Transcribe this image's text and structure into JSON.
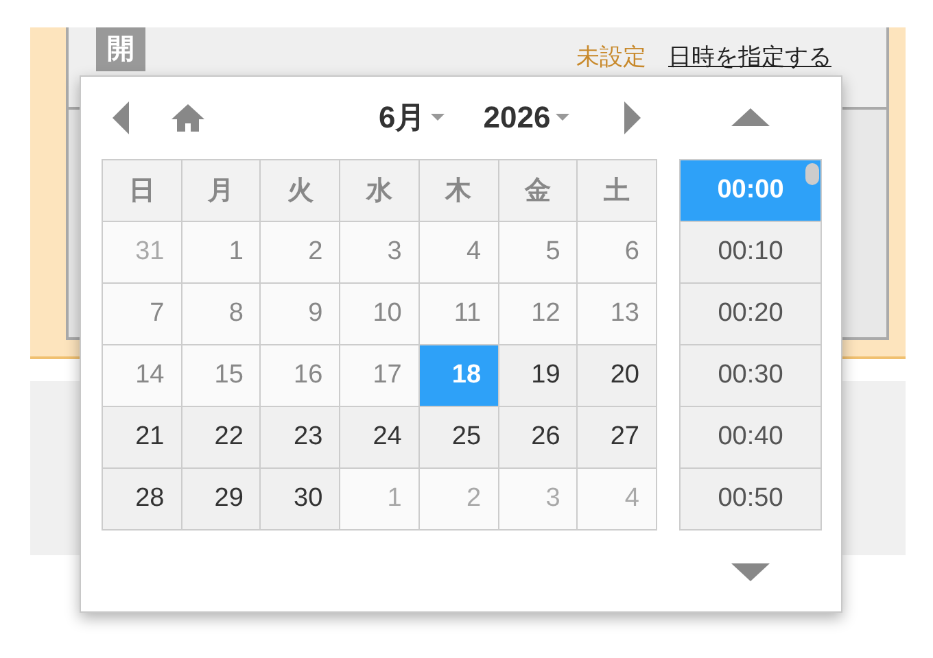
{
  "form": {
    "badge": "開",
    "status": "未設定",
    "link": "日時を指定する"
  },
  "picker": {
    "month": "6月",
    "year": "2026",
    "weekdays": [
      "日",
      "月",
      "火",
      "水",
      "木",
      "金",
      "土"
    ],
    "days": [
      {
        "label": "31",
        "kind": "other",
        "selected": false
      },
      {
        "label": "1",
        "kind": "past",
        "selected": false
      },
      {
        "label": "2",
        "kind": "past",
        "selected": false
      },
      {
        "label": "3",
        "kind": "past",
        "selected": false
      },
      {
        "label": "4",
        "kind": "past",
        "selected": false
      },
      {
        "label": "5",
        "kind": "past",
        "selected": false
      },
      {
        "label": "6",
        "kind": "past",
        "selected": false
      },
      {
        "label": "7",
        "kind": "past",
        "selected": false
      },
      {
        "label": "8",
        "kind": "past",
        "selected": false
      },
      {
        "label": "9",
        "kind": "past",
        "selected": false
      },
      {
        "label": "10",
        "kind": "past",
        "selected": false
      },
      {
        "label": "11",
        "kind": "past",
        "selected": false
      },
      {
        "label": "12",
        "kind": "past",
        "selected": false
      },
      {
        "label": "13",
        "kind": "past",
        "selected": false
      },
      {
        "label": "14",
        "kind": "past",
        "selected": false
      },
      {
        "label": "15",
        "kind": "past",
        "selected": false
      },
      {
        "label": "16",
        "kind": "past",
        "selected": false
      },
      {
        "label": "17",
        "kind": "past",
        "selected": false
      },
      {
        "label": "18",
        "kind": "open",
        "selected": true
      },
      {
        "label": "19",
        "kind": "open",
        "selected": false
      },
      {
        "label": "20",
        "kind": "open",
        "selected": false
      },
      {
        "label": "21",
        "kind": "open",
        "selected": false
      },
      {
        "label": "22",
        "kind": "open",
        "selected": false
      },
      {
        "label": "23",
        "kind": "open",
        "selected": false
      },
      {
        "label": "24",
        "kind": "open",
        "selected": false
      },
      {
        "label": "25",
        "kind": "open",
        "selected": false
      },
      {
        "label": "26",
        "kind": "open",
        "selected": false
      },
      {
        "label": "27",
        "kind": "open",
        "selected": false
      },
      {
        "label": "28",
        "kind": "open",
        "selected": false
      },
      {
        "label": "29",
        "kind": "open",
        "selected": false
      },
      {
        "label": "30",
        "kind": "open",
        "selected": false
      },
      {
        "label": "1",
        "kind": "other",
        "selected": false
      },
      {
        "label": "2",
        "kind": "other",
        "selected": false
      },
      {
        "label": "3",
        "kind": "other",
        "selected": false
      },
      {
        "label": "4",
        "kind": "other",
        "selected": false
      }
    ],
    "times": [
      {
        "label": "00:00",
        "selected": true
      },
      {
        "label": "00:10",
        "selected": false
      },
      {
        "label": "00:20",
        "selected": false
      },
      {
        "label": "00:30",
        "selected": false
      },
      {
        "label": "00:40",
        "selected": false
      },
      {
        "label": "00:50",
        "selected": false
      }
    ]
  }
}
